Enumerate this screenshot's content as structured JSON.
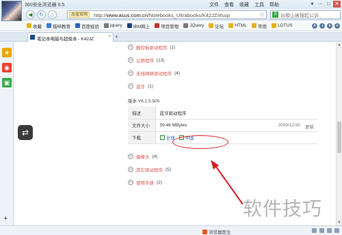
{
  "window": {
    "title": "360安全浏览器 6.5",
    "menu": [
      "文件",
      "查看",
      "收藏",
      "工具",
      "帮助"
    ],
    "controls": [
      "▾",
      "–",
      "□",
      "✕"
    ]
  },
  "nav": {
    "cert_label": "品值官网",
    "url_host": "www.asus.com.cn",
    "url_prefix": "http://",
    "url_path": "/Notebooks_Ultrabooks/K42JZ/#sup",
    "search_placeholder": "谷歌山被搜起公诉"
  },
  "bookmarks": {
    "items": [
      {
        "label": "收藏",
        "color": "#e8b21d"
      },
      {
        "label": "猎柳教育",
        "color": "#3a7bd5"
      },
      {
        "label": "百度经验",
        "color": "#2b66c9"
      },
      {
        "label": "jquery",
        "color": "#7a7a7a"
      },
      {
        "label": "IBM网上",
        "color": "#1f3f7a"
      },
      {
        "label": "项目管理",
        "color": "#c0392b"
      },
      {
        "label": "JQuery",
        "color": "#7a7a7a"
      },
      {
        "label": "论坛",
        "color": "#e8b21d"
      },
      {
        "label": "HTML",
        "color": "#e8b21d"
      },
      {
        "label": "常用",
        "color": "#e8b21d"
      },
      {
        "label": "LOTUS",
        "color": "#e8b21d"
      }
    ],
    "right_icons": [
      "A",
      "◑",
      "⬇",
      "▾"
    ]
  },
  "tab": {
    "label": "笔记本电脑与超极本 - K42JZ",
    "close": "×",
    "new_tab": "+"
  },
  "sidebar": {
    "icons": [
      {
        "name": "star",
        "glyph": "★",
        "color": "#f0a500"
      },
      {
        "name": "weibo",
        "glyph": "◉",
        "color": "#e8452c"
      },
      {
        "name": "app",
        "glyph": "▣",
        "color": "#3ba84a"
      }
    ],
    "plus": "+"
  },
  "content": {
    "rows_top": [
      {
        "label": "触控板驱动程序",
        "count": "(1)"
      },
      {
        "label": "公用程序",
        "count": "(13)"
      },
      {
        "label": "无线网络驱动程序",
        "count": "(4)"
      },
      {
        "label": "蓝牙",
        "count": "(1)"
      }
    ],
    "minus_glyph": "–",
    "version": "版本 V6.2.5.500",
    "table": {
      "rows": [
        {
          "key": "描述",
          "value": "蓝牙驱动程序"
        },
        {
          "key": "文件大小",
          "value": "59.46 MBytes",
          "date": "2009/12/30",
          "update": "更新"
        },
        {
          "key": "下载",
          "link1": "全球",
          "link2": "中国"
        }
      ]
    },
    "rows_bottom": [
      {
        "label": "摄像头",
        "count": "(4)"
      },
      {
        "label": "其它驱动程序",
        "count": "(5)"
      },
      {
        "label": "使用手册",
        "count": "(2)"
      }
    ],
    "side_button_glyph": "⇄"
  },
  "watermark": "软件技巧",
  "status": {
    "label": "浏览器医生"
  },
  "colors": {
    "annotation": "#d42020",
    "link_red": "#d9534f",
    "link_blue": "#2a62b8"
  }
}
